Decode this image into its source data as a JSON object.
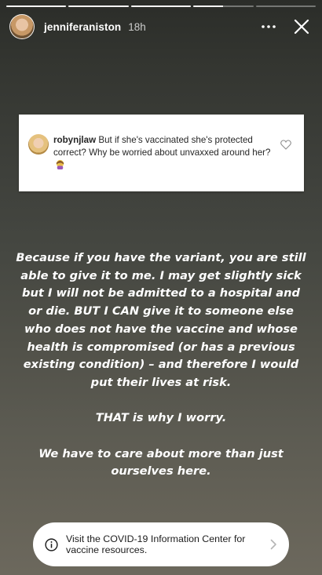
{
  "progress": {
    "segments": [
      1,
      1,
      1,
      0.5,
      0
    ]
  },
  "header": {
    "username": "jenniferaniston",
    "time": "18h",
    "icons": {
      "avatar": "profile-avatar",
      "more": "more-options-icon",
      "close": "close-icon"
    }
  },
  "reply_card": {
    "username": "robynjlaw",
    "question": "But if she's vaccinated she's protected correct? Why be worried about unvaxxed around her?",
    "icons": {
      "avatar": "commenter-avatar",
      "emoji": "woman-facepalming-emoji",
      "heart": "heart-icon"
    }
  },
  "story": {
    "paragraph_1": "Because if you have the variant, you are still able to give it to me. I may get slightly sick but I will not be admitted to a hospital and or die. BUT I CAN give it to someone else who does not have the vaccine and whose health is compromised (or has a previous existing condition) – and therefore I would put their lives at risk.",
    "paragraph_2": "THAT is why I worry.",
    "paragraph_3": "We have to care about more than just ourselves here."
  },
  "covid_sticker": {
    "text": "Visit the COVID-19 Information Center for vaccine resources.",
    "icons": {
      "info": "info-icon",
      "chevron": "chevron-right-icon"
    }
  },
  "colors": {
    "background_top": "#2b2d29",
    "background_bottom": "#6c685d",
    "card": "#ffffff",
    "text": "#ffffff"
  }
}
